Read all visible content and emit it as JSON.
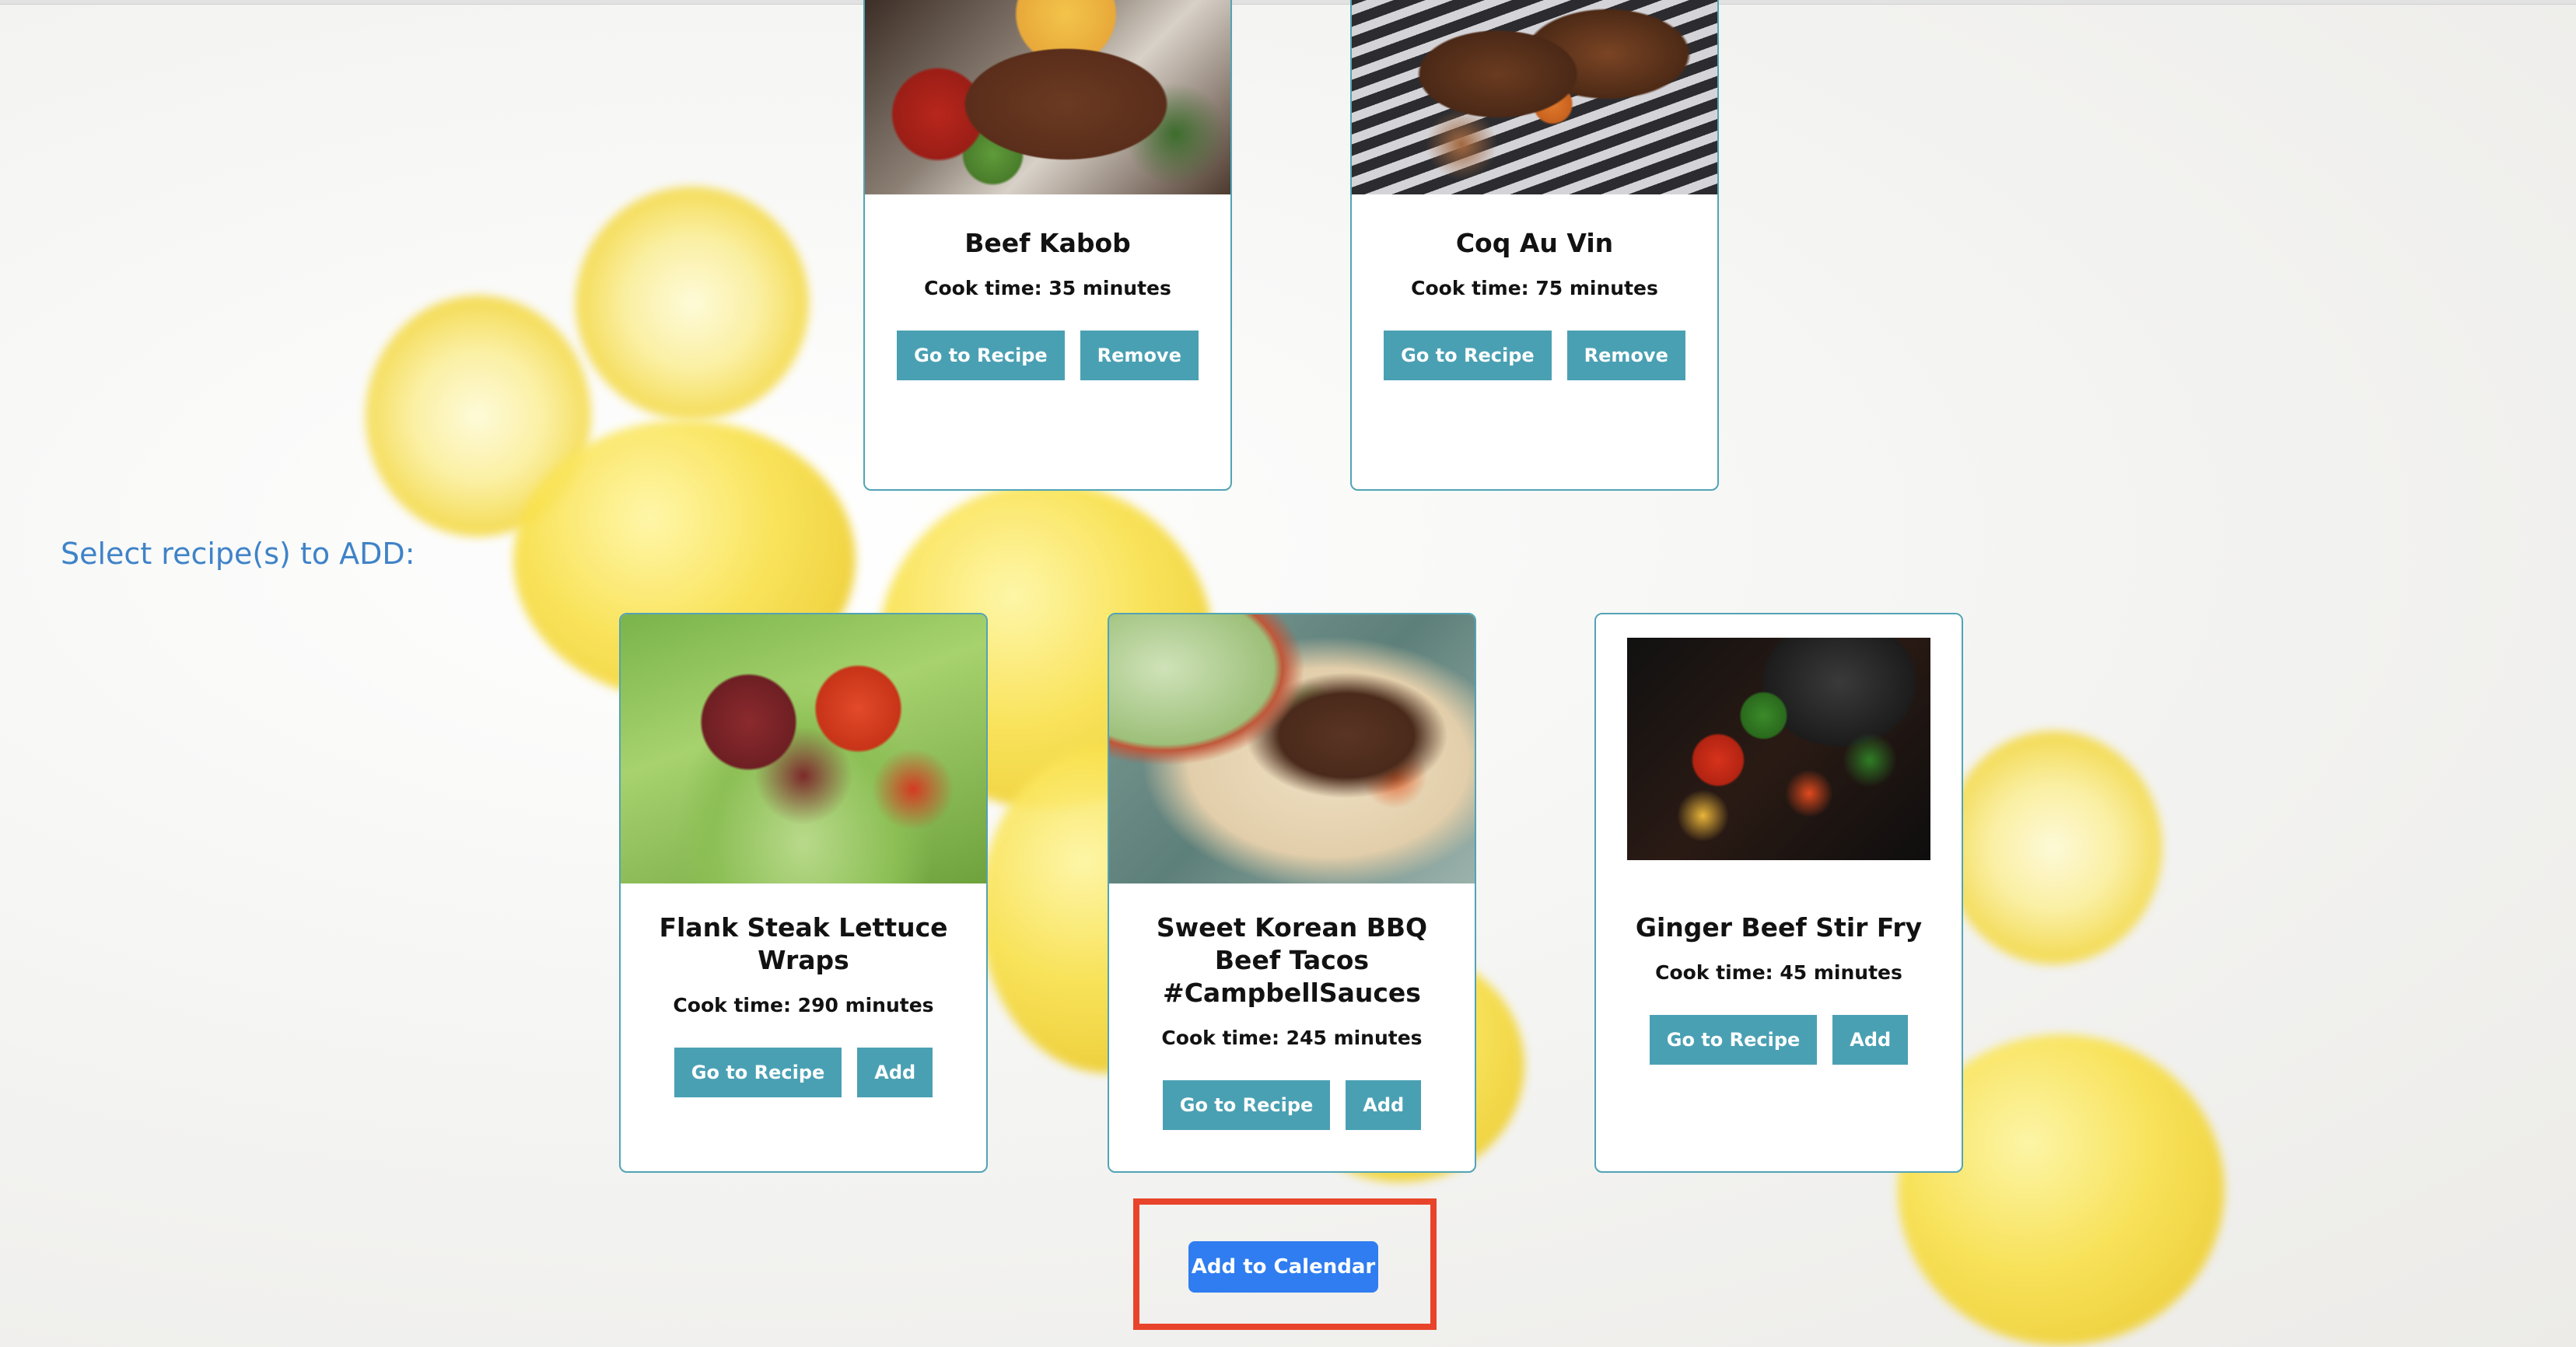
{
  "section": {
    "add_label": "Select recipe(s) to ADD:"
  },
  "current_recipes": [
    {
      "name": "Beef Kabob",
      "cook_time": "Cook time: 35 minutes",
      "primary_btn": "Go to Recipe",
      "secondary_btn": "Remove"
    },
    {
      "name": "Coq Au Vin",
      "cook_time": "Cook time: 75 minutes",
      "primary_btn": "Go to Recipe",
      "secondary_btn": "Remove"
    }
  ],
  "add_recipes": [
    {
      "name": "Flank Steak Lettuce Wraps",
      "cook_time": "Cook time: 290 minutes",
      "primary_btn": "Go to Recipe",
      "secondary_btn": "Add"
    },
    {
      "name": "Sweet Korean BBQ Beef Tacos #CampbellSauces",
      "cook_time": "Cook time: 245 minutes",
      "primary_btn": "Go to Recipe",
      "secondary_btn": "Add"
    },
    {
      "name": "Ginger Beef Stir Fry",
      "cook_time": "Cook time: 45 minutes",
      "primary_btn": "Go to Recipe",
      "secondary_btn": "Add"
    }
  ],
  "calendar": {
    "button_label": "Add to Calendar"
  },
  "colors": {
    "card_border": "#52a3b5",
    "button_teal": "#4aa0b3",
    "calendar_button": "#2f7df0",
    "section_label": "#3f83c8",
    "highlight": "#e8442b"
  }
}
